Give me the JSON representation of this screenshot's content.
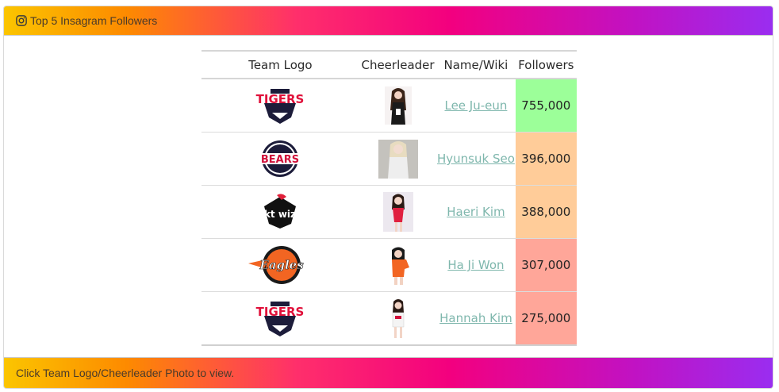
{
  "header": {
    "title": "Top 5 Insagram Followers",
    "icon": "instagram-icon"
  },
  "table": {
    "columns": [
      "Team Logo",
      "Cheerleader",
      "Name/Wiki",
      "Followers"
    ],
    "rows": [
      {
        "team_logo": "tigers-logo",
        "logo_text": "TIGERS",
        "photo": "cheerleader-photo",
        "name": "Lee Ju-eun",
        "followers": "755,000",
        "color": "#9cff99"
      },
      {
        "team_logo": "bears-logo",
        "logo_text": "BEARS",
        "photo": "cheerleader-photo",
        "name": "Hyunsuk Seo",
        "followers": "396,000",
        "color": "#ffcc99"
      },
      {
        "team_logo": "ktwiz-logo",
        "logo_text": "kt wiz",
        "photo": "cheerleader-photo",
        "name": "Haeri Kim",
        "followers": "388,000",
        "color": "#ffcc99"
      },
      {
        "team_logo": "eagles-logo",
        "logo_text": "Eagles",
        "photo": "cheerleader-photo",
        "name": "Ha Ji Won",
        "followers": "307,000",
        "color": "#ffa699"
      },
      {
        "team_logo": "tigers-logo",
        "logo_text": "TIGERS",
        "photo": "cheerleader-photo",
        "name": "Hannah Kim",
        "followers": "275,000",
        "color": "#ffa699"
      }
    ]
  },
  "footer": {
    "text": "Click Team Logo/Cheerleader Photo to view."
  },
  "colors": {
    "gradient": [
      "#fbc500",
      "#ff2f6b",
      "#f3007f",
      "#9a2df0"
    ],
    "link": "#7fb7ad"
  }
}
